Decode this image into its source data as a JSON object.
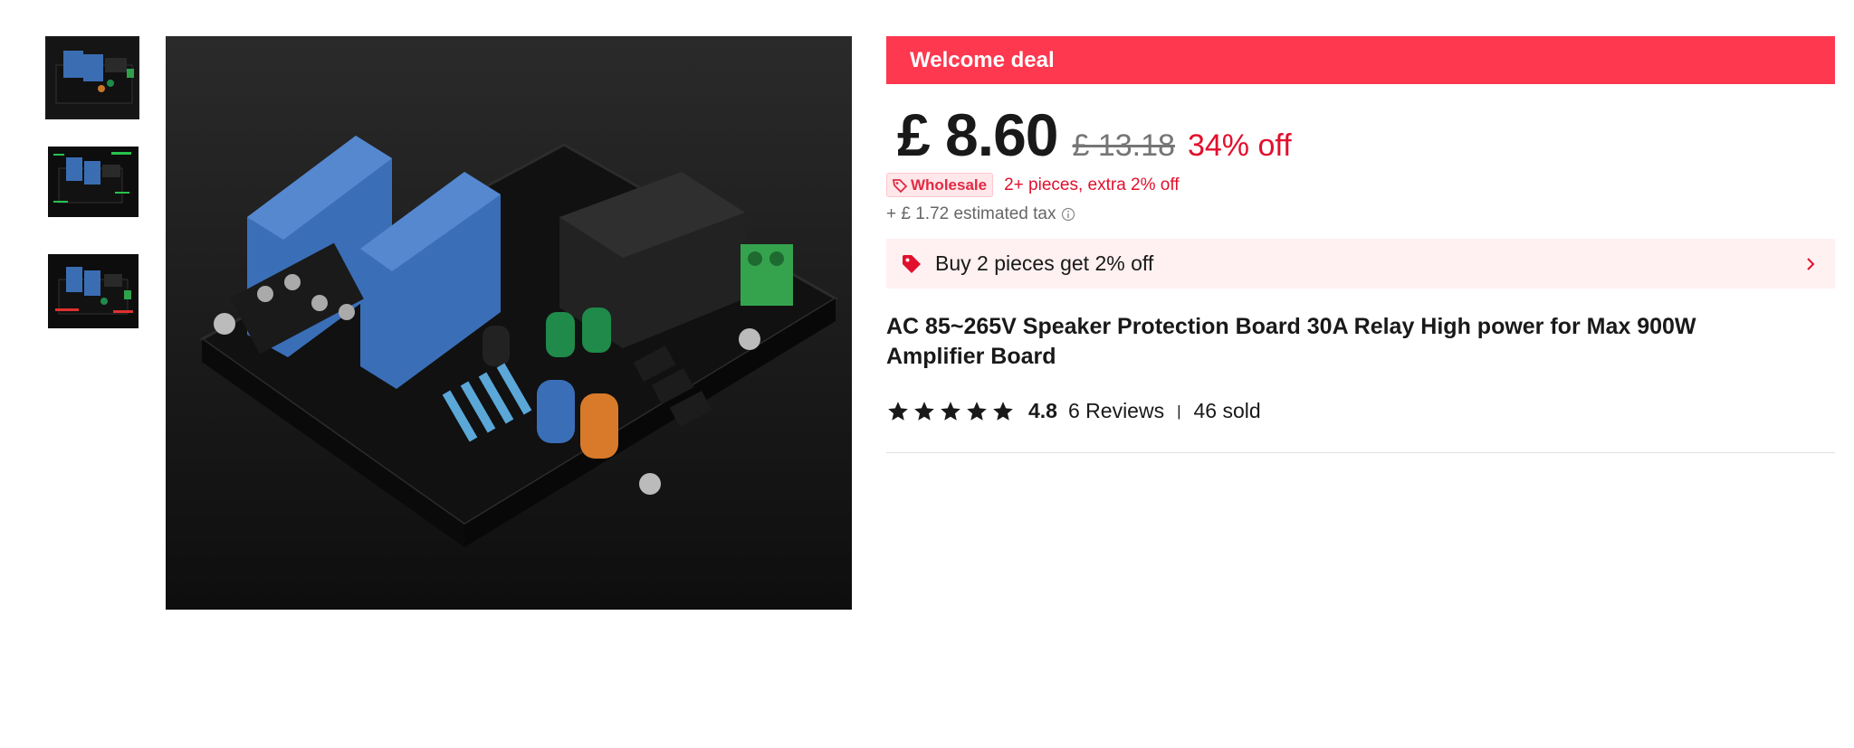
{
  "gallery": {
    "thumbnails": [
      {
        "label": "thumbnail-1",
        "selected": true
      },
      {
        "label": "thumbnail-2",
        "selected": false
      },
      {
        "label": "thumbnail-3",
        "selected": false
      }
    ]
  },
  "deal": {
    "banner": "Welcome deal"
  },
  "pricing": {
    "price": "£ 8.60",
    "original_price": "£ 13.18",
    "discount": "34% off",
    "wholesale_badge": "Wholesale",
    "wholesale_text": "2+ pieces, extra 2% off",
    "tax": "+ £ 1.72 estimated tax"
  },
  "promo": {
    "text": "Buy 2 pieces get 2% off"
  },
  "product": {
    "title": "AC 85~265V Speaker Protection Board 30A Relay High power for Max 900W Amplifier Board"
  },
  "rating": {
    "stars": 5,
    "value": "4.8",
    "reviews": "6 Reviews",
    "sold": "46 sold"
  },
  "colors": {
    "accent": "#fd384f",
    "discount": "#e1102d",
    "promo_bg": "#fff0f1"
  }
}
